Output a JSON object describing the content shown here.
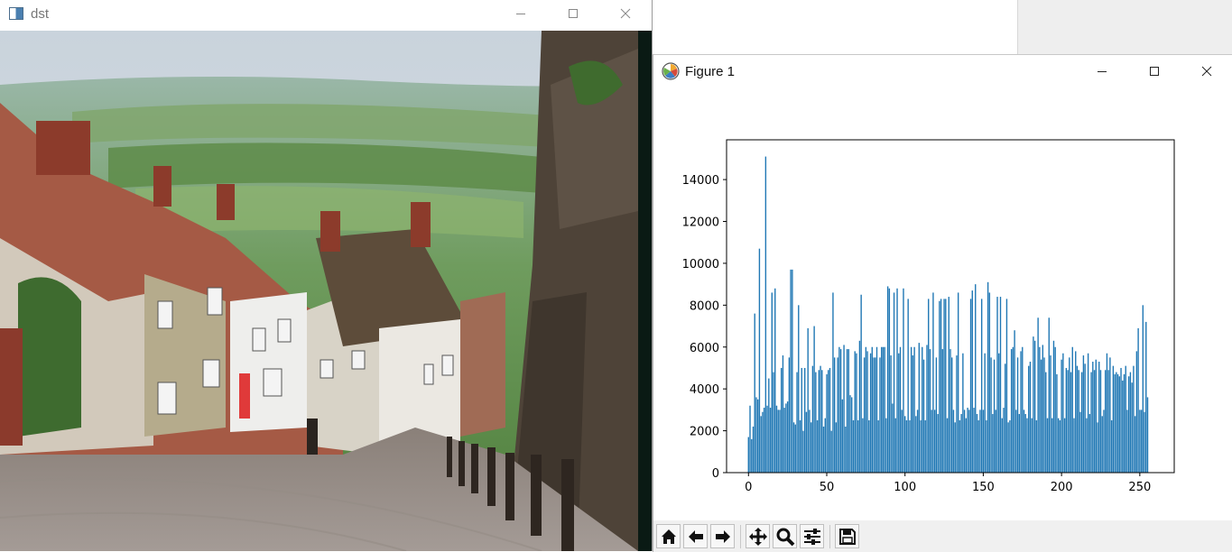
{
  "desktop": {},
  "dst_window": {
    "title": "dst",
    "controls": [
      "minimize-icon",
      "maximize-icon",
      "close-icon"
    ]
  },
  "figure_window": {
    "title": "Figure 1",
    "controls": [
      "minimize-icon",
      "maximize-icon",
      "close-icon"
    ],
    "toolbar": [
      "home-icon",
      "back-arrow-icon",
      "forward-arrow-icon",
      "pan-icon",
      "zoom-icon",
      "configure-subplots-icon",
      "save-icon"
    ]
  },
  "chart_data": {
    "type": "bar",
    "title": "",
    "xlabel": "",
    "ylabel": "",
    "xlim": [
      -14,
      272
    ],
    "ylim": [
      0,
      15900
    ],
    "xticks": [
      0,
      50,
      100,
      150,
      200,
      250
    ],
    "yticks": [
      0,
      2000,
      4000,
      6000,
      8000,
      10000,
      12000,
      14000
    ],
    "grid": false,
    "color": "#1f77b4",
    "x_start": 0,
    "values": [
      1700,
      3200,
      1600,
      2200,
      7600,
      3600,
      3500,
      10700,
      2700,
      2900,
      3100,
      15100,
      3200,
      4500,
      3100,
      8600,
      4800,
      8800,
      3200,
      3000,
      3000,
      5000,
      5600,
      3100,
      3300,
      3400,
      5500,
      9700,
      9700,
      2400,
      2300,
      4800,
      8000,
      2500,
      5000,
      2000,
      5000,
      2900,
      6900,
      3000,
      2400,
      5100,
      7000,
      4800,
      2500,
      4900,
      5100,
      4900,
      2200,
      2600,
      4700,
      4900,
      5000,
      2000,
      8600,
      5500,
      2400,
      5500,
      6000,
      5900,
      3500,
      6100,
      2200,
      5900,
      5900,
      3700,
      3600,
      2500,
      5800,
      5700,
      2500,
      6300,
      8500,
      2600,
      5500,
      6000,
      5800,
      2500,
      5700,
      6000,
      5500,
      5500,
      6000,
      2500,
      5500,
      6000,
      6000,
      6000,
      2600,
      8900,
      8800,
      5600,
      3300,
      8600,
      2600,
      8800,
      5700,
      6000,
      3000,
      8800,
      2700,
      2500,
      8300,
      2500,
      6000,
      5600,
      6000,
      2700,
      3000,
      6200,
      2500,
      6000,
      5400,
      2500,
      6100,
      8300,
      5900,
      3000,
      8600,
      3000,
      5500,
      2800,
      8200,
      8300,
      5900,
      8300,
      8300,
      2600,
      8400,
      5900,
      5500,
      3000,
      2400,
      5600,
      8600,
      2500,
      2800,
      5700,
      3000,
      2600,
      3100,
      3000,
      8300,
      8700,
      3100,
      9000,
      2800,
      2500,
      3000,
      8300,
      3000,
      5700,
      2500,
      9100,
      8600,
      5500,
      2800,
      5400,
      3000,
      8400,
      5700,
      8400,
      2600,
      3100,
      5200,
      8300,
      2400,
      2500,
      5900,
      6000,
      6800,
      3000,
      5500,
      2800,
      5800,
      6000,
      3000,
      2800,
      2600,
      5100,
      5300,
      2600,
      6500,
      6300,
      2500,
      7400,
      6000,
      5400,
      6100,
      5500,
      4800,
      2600,
      7400,
      5600,
      2600,
      6300,
      6000,
      4700,
      2600,
      2500,
      5400,
      5700,
      2600,
      5000,
      4900,
      5500,
      4800,
      6000,
      2600,
      5800,
      5100,
      4900,
      2900,
      4800,
      5600,
      5200,
      2600,
      5700,
      2800,
      4800,
      5300,
      4900,
      5400,
      2400,
      5300,
      4900,
      2700,
      3000,
      4900,
      5700,
      4900,
      5500,
      2500,
      5100,
      4700,
      4800,
      4700,
      4600,
      5000,
      4400,
      4700,
      5100,
      3000,
      4600,
      4800,
      4300,
      5100,
      2700,
      5800,
      6900,
      3000,
      3000,
      8000,
      2900,
      7200,
      3600
    ]
  }
}
